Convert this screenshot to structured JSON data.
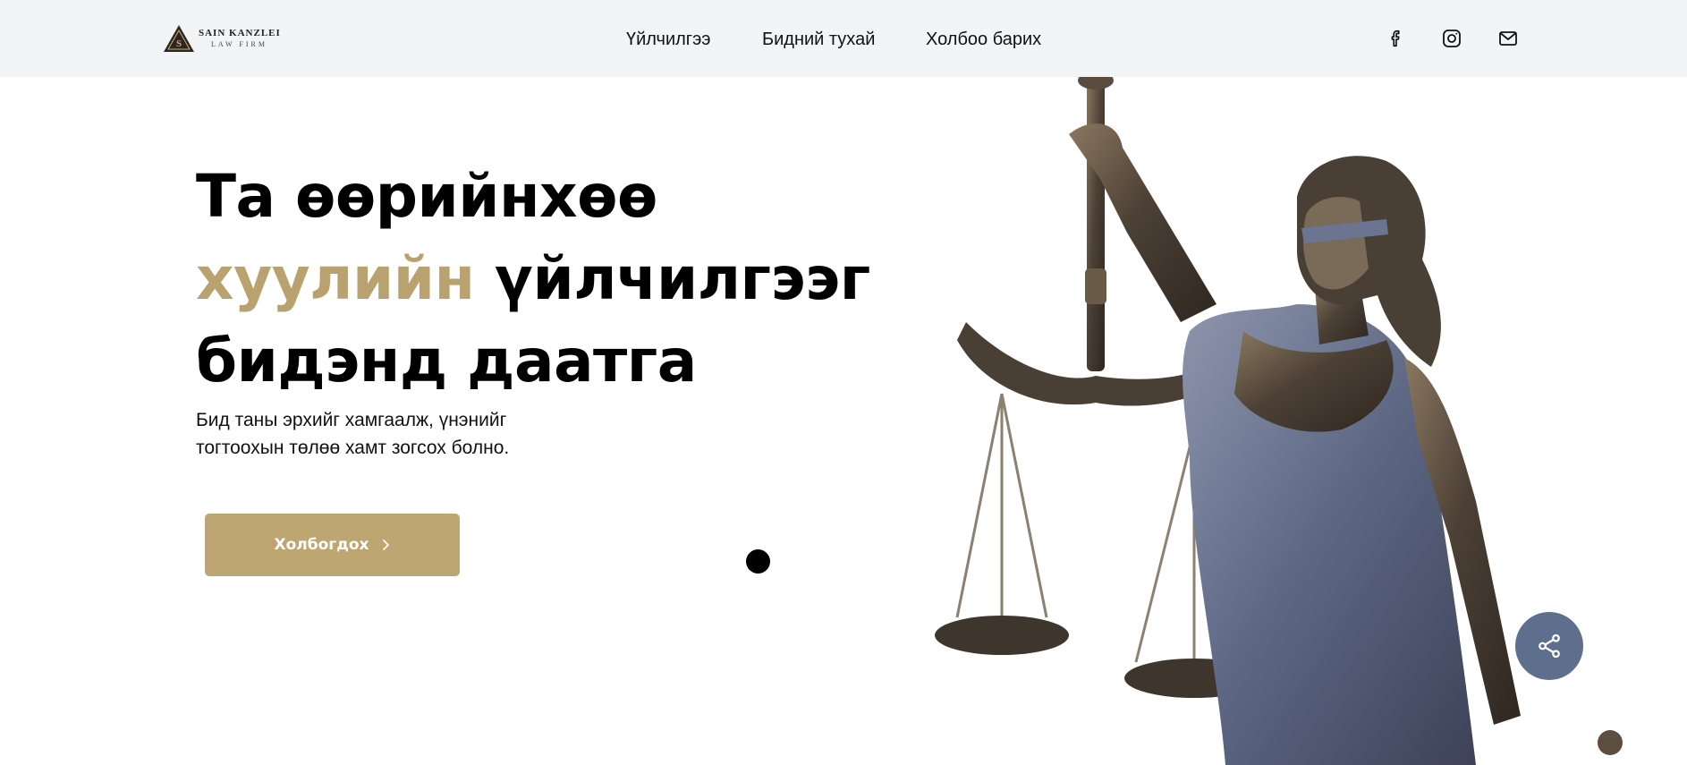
{
  "header": {
    "logo": {
      "line1": "SAIN KANZLEI",
      "line2": "LAW FIRM",
      "mark": "S"
    },
    "nav": [
      {
        "label": "Үйлчилгээ"
      },
      {
        "label": "Бидний тухай"
      },
      {
        "label": "Холбоо барих"
      }
    ],
    "social": [
      {
        "icon": "facebook-icon"
      },
      {
        "icon": "instagram-icon"
      },
      {
        "icon": "mail-icon"
      }
    ]
  },
  "hero": {
    "title_line1": "Та өөрийнхөө",
    "title_accent": "хуулийн",
    "title_line2_rest": " үйлчилгээг",
    "title_line3": "бидэнд даатга",
    "subtitle_line1": "Бид таны эрхийг хамгаалж, үнэнийг",
    "subtitle_line2": "тогтоохын төлөө хамт зогсох болно.",
    "cta_label": "Холбогдох",
    "cta_icon": "chevron-right-icon"
  },
  "floating": {
    "share_icon": "share-icon"
  },
  "colors": {
    "accent": "#b9a26f",
    "button": "#bda672",
    "topbar": "#f2f4f6",
    "share": "#5d6f8c"
  }
}
